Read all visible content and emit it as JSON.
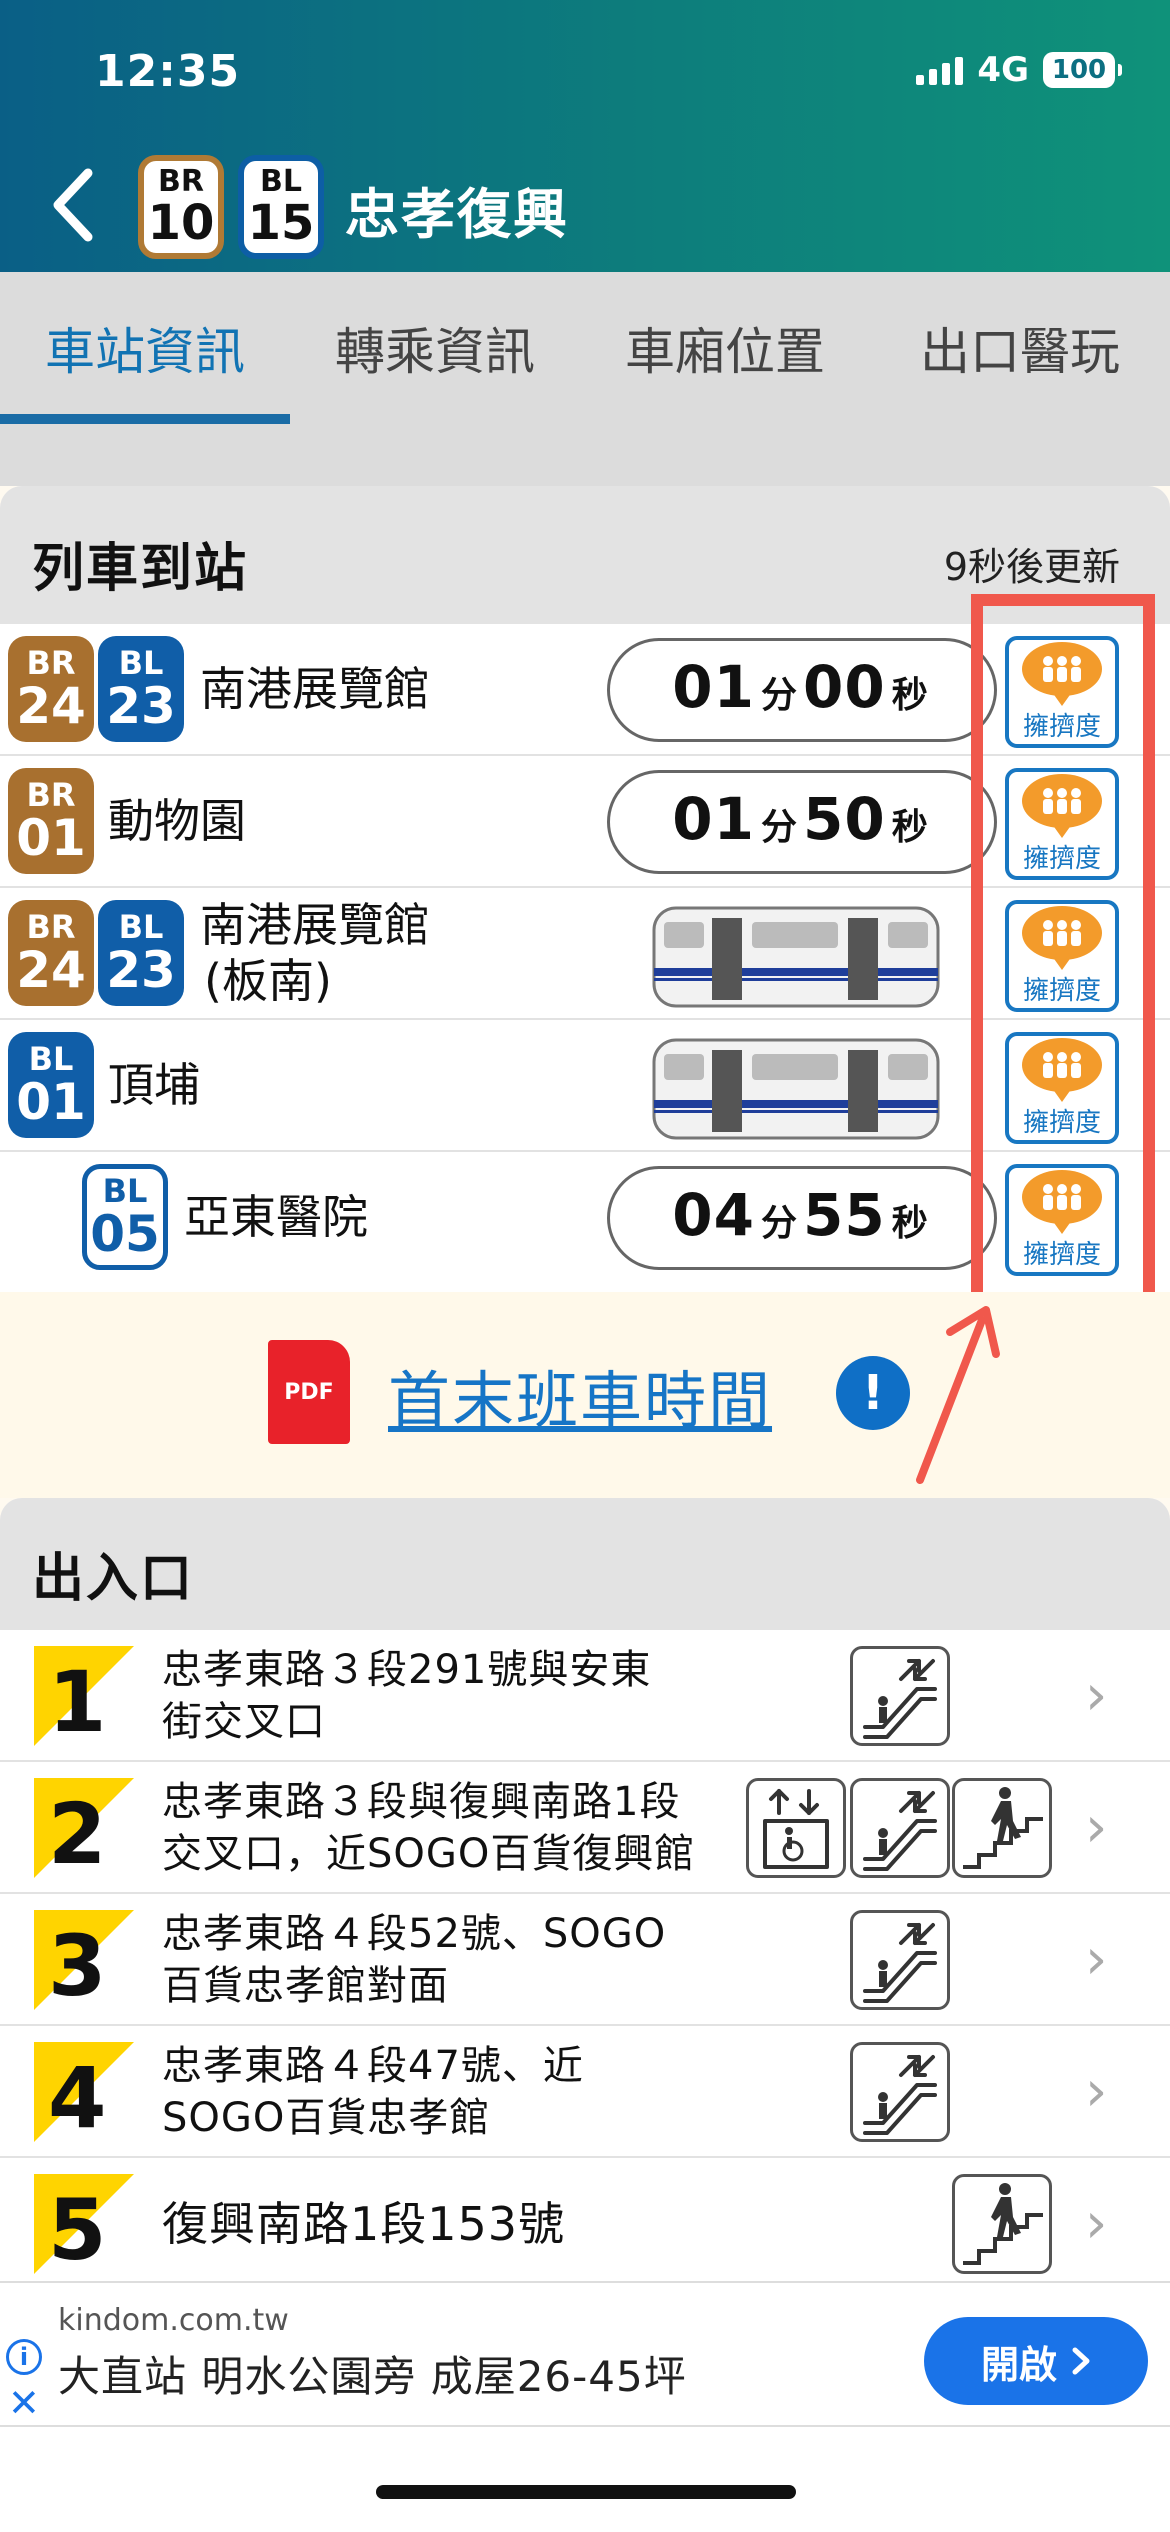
{
  "status_bar": {
    "time": "12:35",
    "network": "4G",
    "battery": "100"
  },
  "header": {
    "badges": [
      {
        "line": "BR",
        "num": "10"
      },
      {
        "line": "BL",
        "num": "15"
      }
    ],
    "station": "忠孝復興"
  },
  "tabs": [
    {
      "label": "車站資訊",
      "active": true
    },
    {
      "label": "轉乘資訊",
      "active": false
    },
    {
      "label": "車廂位置",
      "active": false
    },
    {
      "label": "出口醫玩",
      "active": false
    }
  ],
  "arrivals": {
    "title": "列車到站",
    "update_text": "9秒後更新",
    "crowd_label": "擁擠度",
    "rows": [
      {
        "badges": [
          "BR 24",
          "BL 23"
        ],
        "dest": "南港展覽館",
        "dest2": "",
        "min": "01",
        "sec": "00",
        "min_unit": "分",
        "sec_unit": "秒",
        "arriving": false
      },
      {
        "badges": [
          "BR 01"
        ],
        "dest": "動物園",
        "dest2": "",
        "min": "01",
        "sec": "50",
        "min_unit": "分",
        "sec_unit": "秒",
        "arriving": false
      },
      {
        "badges": [
          "BR 24",
          "BL 23"
        ],
        "dest": "南港展覽館",
        "dest2": "(板南)",
        "arriving": true
      },
      {
        "badges": [
          "BL 01"
        ],
        "dest": "頂埔",
        "dest2": "",
        "arriving": true
      },
      {
        "badges": [
          "BL 05"
        ],
        "dest": "亞東醫院",
        "dest2": "",
        "min": "04",
        "sec": "55",
        "min_unit": "分",
        "sec_unit": "秒",
        "arriving": false
      }
    ]
  },
  "timetable": {
    "pdf_label": "PDF",
    "link_text": "首末班車時間",
    "info_icon": "!"
  },
  "exits": {
    "title": "出入口",
    "rows": [
      {
        "num": "1",
        "line1": "忠孝東路３段291號與安東",
        "line2": "街交叉口",
        "facilities": [
          "escalator"
        ]
      },
      {
        "num": "2",
        "line1": "忠孝東路３段與復興南路1段",
        "line2": "交叉口，近SOGO百貨復興館",
        "facilities": [
          "elevator",
          "escalator",
          "stairs"
        ]
      },
      {
        "num": "3",
        "line1": "忠孝東路４段52號、SOGO",
        "line2": "百貨忠孝館對面",
        "facilities": [
          "escalator"
        ]
      },
      {
        "num": "4",
        "line1": "忠孝東路４段47號、近",
        "line2": "SOGO百貨忠孝館",
        "facilities": [
          "escalator"
        ]
      },
      {
        "num": "5",
        "line1": "復興南路1段153號",
        "line2": "",
        "facilities": [
          "stairs"
        ]
      }
    ]
  },
  "ad": {
    "domain": "kindom.com.tw",
    "headline": "大直站 明水公園旁 成屋26-45坪",
    "cta": "開啟"
  },
  "colors": {
    "br": "#a8702f",
    "bl": "#105ea8",
    "highlight": "#f0584c",
    "link": "#1675c6"
  }
}
